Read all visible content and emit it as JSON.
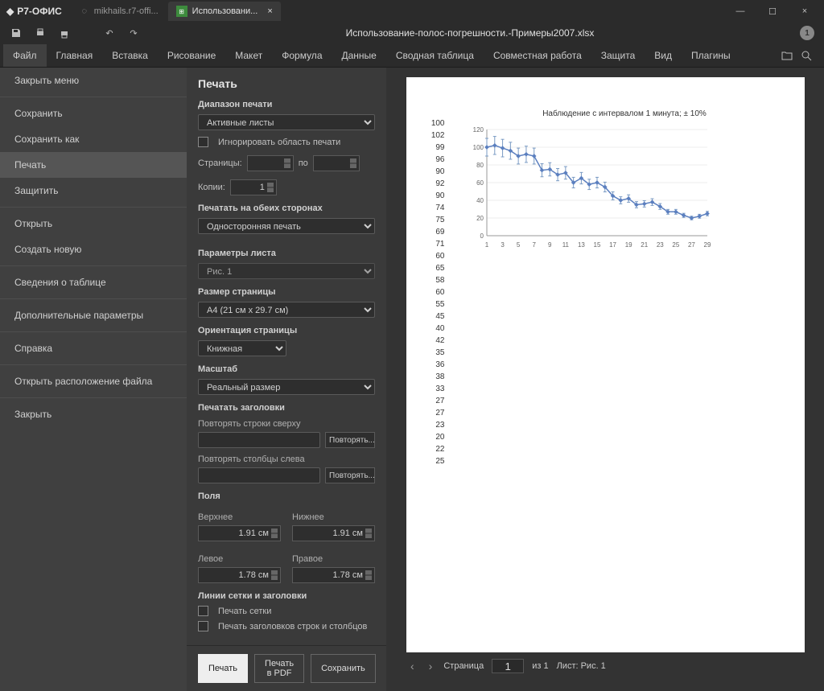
{
  "app": {
    "name": "Р7-ОФИС"
  },
  "tabs": [
    {
      "label": "mikhails.r7-offi..."
    },
    {
      "label": "Использовани..."
    }
  ],
  "doc_title": "Использование-полос-погрешности.-Примеры2007.xlsx",
  "avatar_initial": "1",
  "menu": [
    "Файл",
    "Главная",
    "Вставка",
    "Рисование",
    "Макет",
    "Формула",
    "Данные",
    "Сводная таблица",
    "Совместная работа",
    "Защита",
    "Вид",
    "Плагины"
  ],
  "sidebar": {
    "close_menu": "Закрыть меню",
    "items1": [
      "Сохранить",
      "Сохранить как",
      "Печать",
      "Защитить"
    ],
    "items2": [
      "Открыть",
      "Создать новую"
    ],
    "items3": [
      "Сведения о таблице"
    ],
    "items4": [
      "Дополнительные параметры"
    ],
    "items5": [
      "Справка"
    ],
    "items6": [
      "Открыть расположение файла"
    ],
    "items7": [
      "Закрыть"
    ]
  },
  "print": {
    "title": "Печать",
    "range_label": "Диапазон печати",
    "range_value": "Активные листы",
    "ignore_label": "Игнорировать область печати",
    "pages_label": "Страницы:",
    "pages_to": "по",
    "copies_label": "Копии:",
    "copies_value": "1",
    "duplex_label": "Печатать на обеих сторонах",
    "duplex_value": "Односторонняя печать",
    "sheet_label": "Параметры листа",
    "sheet_value": "Рис. 1",
    "size_label": "Размер страницы",
    "size_value": "A4 (21 см x 29.7 см)",
    "orient_label": "Ориентация страницы",
    "orient_value": "Книжная",
    "scale_label": "Масштаб",
    "scale_value": "Реальный размер",
    "headers_label": "Печатать заголовки",
    "repeat_rows": "Повторять строки сверху",
    "repeat_cols": "Повторять столбцы слева",
    "repeat_btn": "Повторять...",
    "margins_label": "Поля",
    "m_top": "Верхнее",
    "m_bottom": "Нижнее",
    "m_left": "Левое",
    "m_right": "Правое",
    "mv_top": "1.91 см",
    "mv_bottom": "1.91 см",
    "mv_left": "1.78 см",
    "mv_right": "1.78 см",
    "grid_label": "Линии сетки и заголовки",
    "grid_chk": "Печать сетки",
    "head_chk": "Печать заголовков строк и столбцов",
    "btn_print": "Печать",
    "btn_pdf": "Печать в PDF",
    "btn_save": "Сохранить"
  },
  "nav": {
    "page_label": "Страница",
    "page_val": "1",
    "of": "из 1",
    "sheet": "Лист: Рис. 1"
  },
  "numcol": [
    "100",
    "102",
    "99",
    "96",
    "90",
    "92",
    "90",
    "74",
    "75",
    "69",
    "71",
    "60",
    "65",
    "58",
    "60",
    "55",
    "45",
    "40",
    "42",
    "35",
    "36",
    "38",
    "33",
    "27",
    "27",
    "23",
    "20",
    "22",
    "25"
  ],
  "chart_data": {
    "type": "line",
    "title": "Наблюдение с интервалом 1 минута; ± 10%",
    "xlabel": "",
    "ylabel": "",
    "xlim": [
      1,
      29
    ],
    "ylim": [
      0,
      120
    ],
    "yticks": [
      0,
      20,
      40,
      60,
      80,
      100,
      120
    ],
    "xticks": [
      1,
      3,
      5,
      7,
      9,
      11,
      13,
      15,
      17,
      19,
      21,
      23,
      25,
      27,
      29
    ],
    "x": [
      1,
      2,
      3,
      4,
      5,
      6,
      7,
      8,
      9,
      10,
      11,
      12,
      13,
      14,
      15,
      16,
      17,
      18,
      19,
      20,
      21,
      22,
      23,
      24,
      25,
      26,
      27,
      28,
      29
    ],
    "y": [
      100,
      102,
      99,
      96,
      90,
      92,
      90,
      74,
      75,
      69,
      71,
      60,
      65,
      58,
      60,
      55,
      45,
      40,
      42,
      35,
      36,
      38,
      33,
      27,
      27,
      23,
      20,
      22,
      25
    ],
    "error_pct": 10
  }
}
